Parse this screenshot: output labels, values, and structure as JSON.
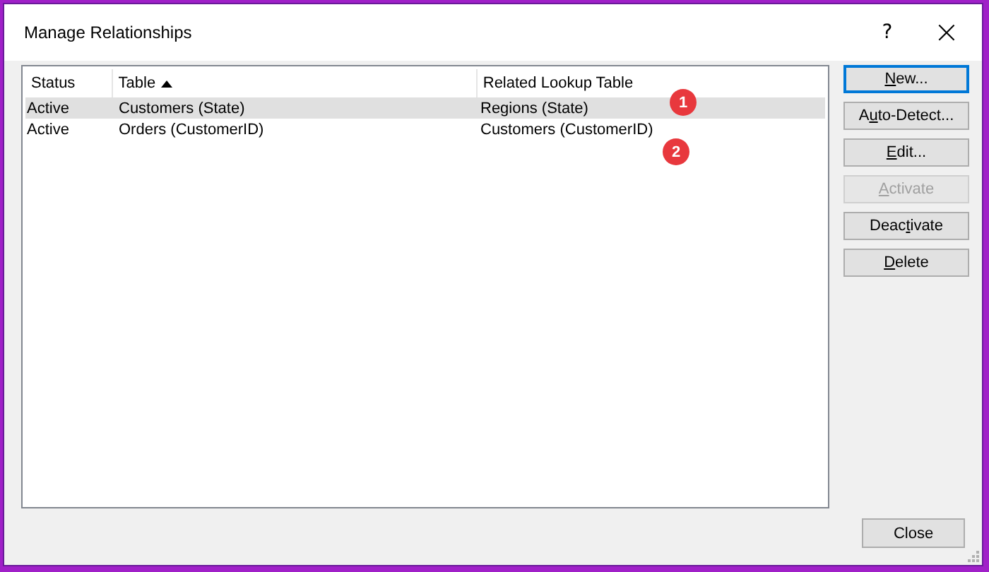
{
  "window": {
    "title": "Manage Relationships",
    "help": "?",
    "close": "×"
  },
  "table": {
    "columns": [
      {
        "label": "Status",
        "sorted": false
      },
      {
        "label": "Table",
        "sorted": true
      },
      {
        "label": "Related Lookup Table",
        "sorted": false
      }
    ],
    "rows": [
      {
        "cells": [
          "Active",
          "Customers (State)",
          "Regions (State)"
        ],
        "selected": true,
        "marker": "1"
      },
      {
        "cells": [
          "Active",
          "Orders (CustomerID)",
          "Customers (CustomerID)"
        ],
        "selected": false,
        "marker": "2"
      }
    ]
  },
  "buttons": [
    {
      "segments": [
        {
          "text": "N",
          "access_key": true
        },
        {
          "text": "ew...",
          "access_key": false
        }
      ],
      "default": true,
      "disabled": false
    },
    {
      "segments": [
        {
          "text": "A",
          "access_key": false
        },
        {
          "text": "u",
          "access_key": true
        },
        {
          "text": "to-Detect...",
          "access_key": false
        }
      ],
      "default": false,
      "disabled": false
    },
    {
      "segments": [
        {
          "text": "E",
          "access_key": true
        },
        {
          "text": "dit...",
          "access_key": false
        }
      ],
      "default": false,
      "disabled": false
    },
    {
      "segments": [
        {
          "text": "A",
          "access_key": true
        },
        {
          "text": "ctivate",
          "access_key": false
        }
      ],
      "default": false,
      "disabled": true
    },
    {
      "segments": [
        {
          "text": "Deac",
          "access_key": false
        },
        {
          "text": "t",
          "access_key": true
        },
        {
          "text": "ivate",
          "access_key": false
        }
      ],
      "default": false,
      "disabled": false
    },
    {
      "segments": [
        {
          "text": "D",
          "access_key": true
        },
        {
          "text": "elete",
          "access_key": false
        }
      ],
      "default": false,
      "disabled": false
    }
  ],
  "close_button": {
    "label": "Close"
  }
}
